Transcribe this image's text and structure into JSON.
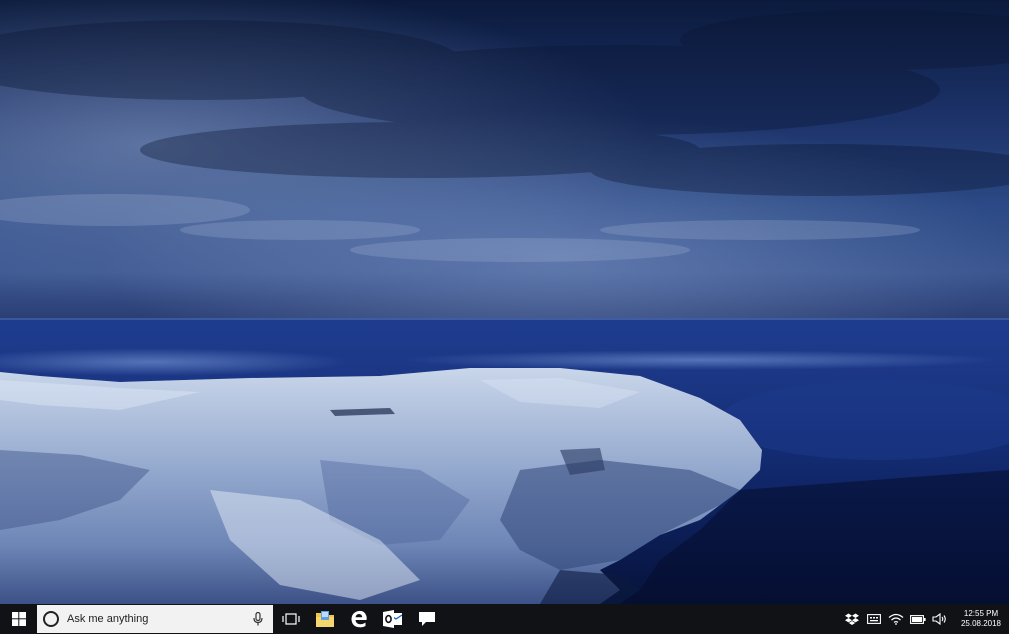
{
  "taskbar": {
    "search": {
      "placeholder": "Ask me anything"
    },
    "pinned_apps": [
      {
        "icon": "task-view-icon"
      },
      {
        "icon": "file-explorer-icon"
      },
      {
        "icon": "edge-icon"
      },
      {
        "icon": "outlook-icon"
      },
      {
        "icon": "message-icon"
      }
    ],
    "tray": {
      "icons": [
        "dropbox-icon",
        "keyboard-icon",
        "wifi-icon",
        "battery-icon",
        "volume-icon"
      ],
      "time": "12:55 PM",
      "date": "25.08.2018"
    }
  },
  "colors": {
    "taskbar_bg": "#101216",
    "search_bg": "#f2f2f2",
    "edge_blue": "#1e90ff",
    "outlook_blue": "#0a64c8"
  }
}
